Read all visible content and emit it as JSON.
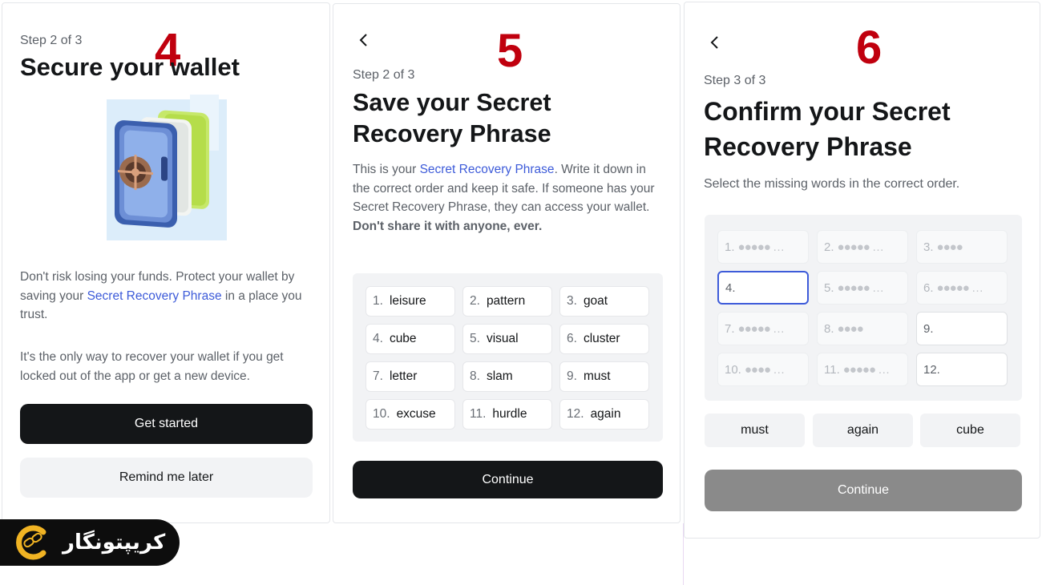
{
  "screens": [
    {
      "number": "4",
      "step": "Step 2 of 3",
      "title": "Secure your wallet",
      "paragraph1_a": "Don't risk losing your funds. Protect your wallet by saving your ",
      "paragraph1_link": "Secret Recovery Phrase",
      "paragraph1_b": " in a place you trust.",
      "paragraph2": "It's the only way to recover your wallet if you get locked out of the app or get a new device.",
      "primary_button": "Get started",
      "secondary_button": "Remind me later"
    },
    {
      "number": "5",
      "step": "Step 2 of 3",
      "title_line1": "Save your Secret",
      "title_line2": "Recovery Phrase",
      "intro_a": "This is your ",
      "intro_link": "Secret Recovery Phrase",
      "intro_b": ". Write it down in the correct order and keep it safe. If someone has your Secret Recovery Phrase, they can access your wallet.",
      "warning": "Don't share it with anyone, ever.",
      "words": [
        {
          "n": "1.",
          "w": "leisure"
        },
        {
          "n": "2.",
          "w": "pattern"
        },
        {
          "n": "3.",
          "w": "goat"
        },
        {
          "n": "4.",
          "w": "cube"
        },
        {
          "n": "5.",
          "w": "visual"
        },
        {
          "n": "6.",
          "w": "cluster"
        },
        {
          "n": "7.",
          "w": "letter"
        },
        {
          "n": "8.",
          "w": "slam"
        },
        {
          "n": "9.",
          "w": "must"
        },
        {
          "n": "10.",
          "w": "excuse"
        },
        {
          "n": "11.",
          "w": "hurdle"
        },
        {
          "n": "12.",
          "w": "again"
        }
      ],
      "button": "Continue"
    },
    {
      "number": "6",
      "step": "Step 3 of 3",
      "title_line1": "Confirm your Secret",
      "title_line2": "Recovery Phrase",
      "instruction": "Select the missing words in the correct order.",
      "slots": [
        {
          "n": "1.",
          "mask": "●●●●● …",
          "state": "hidden"
        },
        {
          "n": "2.",
          "mask": "●●●●● …",
          "state": "hidden"
        },
        {
          "n": "3.",
          "mask": "●●●●",
          "state": "hidden"
        },
        {
          "n": "4.",
          "mask": "",
          "state": "active"
        },
        {
          "n": "5.",
          "mask": "●●●●● …",
          "state": "hidden"
        },
        {
          "n": "6.",
          "mask": "●●●●● …",
          "state": "hidden"
        },
        {
          "n": "7.",
          "mask": "●●●●● …",
          "state": "hidden"
        },
        {
          "n": "8.",
          "mask": "●●●●",
          "state": "hidden"
        },
        {
          "n": "9.",
          "mask": "",
          "state": "open"
        },
        {
          "n": "10.",
          "mask": "●●●●  …",
          "state": "hidden"
        },
        {
          "n": "11.",
          "mask": "●●●●● …",
          "state": "hidden"
        },
        {
          "n": "12.",
          "mask": "",
          "state": "open"
        }
      ],
      "choices": [
        "must",
        "again",
        "cube"
      ],
      "button": "Continue"
    }
  ],
  "watermark": {
    "text": "کریپتونگار",
    "icon": "chain-c-logo-icon"
  },
  "colors": {
    "accent_link": "#3d5bd9",
    "step_number": "#c0000e",
    "primary_button": "#141618",
    "disabled_button": "#8a8a8a"
  }
}
